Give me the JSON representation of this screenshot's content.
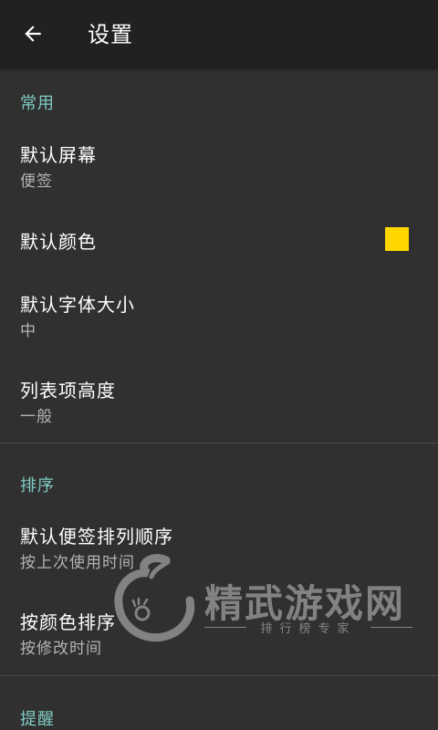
{
  "appbar": {
    "title": "设置",
    "back_icon": "arrow-left-icon"
  },
  "sections": {
    "common": {
      "header": "常用",
      "default_screen": {
        "title": "默认屏幕",
        "summary": "便签"
      },
      "default_color": {
        "title": "默认颜色",
        "swatch_color": "#ffd600"
      },
      "default_font_size": {
        "title": "默认字体大小",
        "summary": "中"
      },
      "list_item_height": {
        "title": "列表项高度",
        "summary": "一般"
      }
    },
    "sort": {
      "header": "排序",
      "default_sort_order": {
        "title": "默认便签排列顺序",
        "summary": "按上次使用时间"
      },
      "sort_by_color": {
        "title": "按颜色排序",
        "summary": "按修改时间"
      }
    },
    "reminder": {
      "header": "提醒"
    }
  },
  "colors": {
    "appbar": "#212121",
    "background": "#303030",
    "section_header": "#80cbc4",
    "title_text": "#ffffff",
    "summary_text": "#b3b3b3"
  },
  "watermark": {
    "name": "精武游戏网",
    "sub": "排行榜专家"
  }
}
